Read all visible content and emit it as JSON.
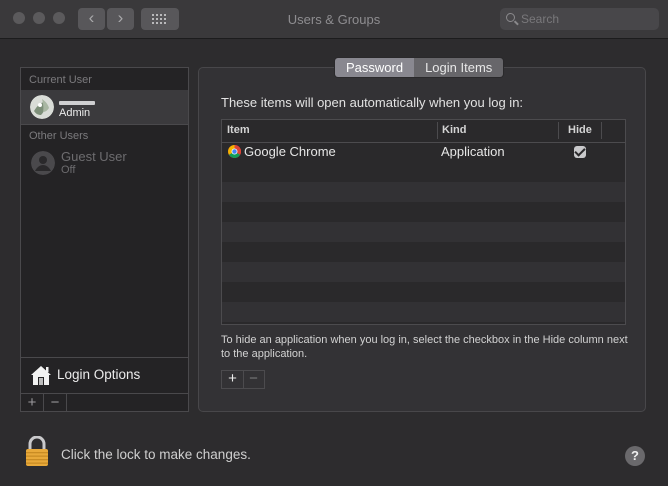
{
  "window": {
    "title": "Users & Groups"
  },
  "toolbar": {
    "back_glyph": "‹",
    "forward_glyph": "›",
    "search_placeholder": "Search"
  },
  "sidebar": {
    "current_user_header": "Current User",
    "current_user": {
      "name": "Admin"
    },
    "other_users_header": "Other Users",
    "other_users": [
      {
        "name": "Guest User",
        "status": "Off"
      }
    ],
    "login_options_label": "Login Options",
    "add_glyph": "+",
    "remove_glyph": "−"
  },
  "tabs": [
    {
      "label": "Password",
      "active": true
    },
    {
      "label": "Login Items",
      "active": false
    }
  ],
  "login_items": {
    "intro": "These items will open automatically when you log in:",
    "columns": {
      "item": "Item",
      "kind": "Kind",
      "hide": "Hide"
    },
    "rows": [
      {
        "item": "Google Chrome",
        "kind": "Application",
        "hide": true
      }
    ],
    "help_text": "To hide an application when you log in, select the checkbox in the Hide column next to the application.",
    "add_glyph": "+",
    "remove_glyph": "−"
  },
  "footer": {
    "lock_text": "Click the lock to make changes.",
    "help_glyph": "?"
  },
  "colors": {
    "window_bg": "#2d2c2e",
    "panel_bg": "#333235",
    "lock_gold": "#e8a93a",
    "active_tab": "#898890"
  },
  "icons": [
    "search-icon",
    "user-avatar-icon",
    "guest-user-icon",
    "house-icon",
    "chrome-icon",
    "lock-icon",
    "checkmark-icon",
    "grid-icon"
  ]
}
